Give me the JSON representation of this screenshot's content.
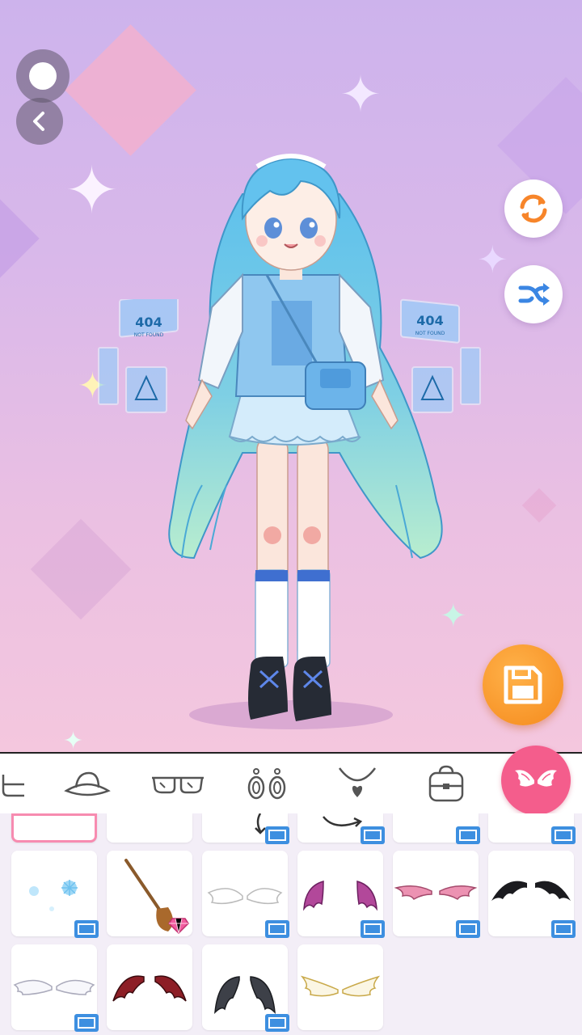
{
  "colors": {
    "accent_pink": "#f45d8c",
    "save_orange": "#f7941d",
    "video_badge_blue": "#3d8fe0",
    "side_icon_orange": "#f7852a",
    "side_icon_blue": "#3b86e3"
  },
  "stage": {
    "top_toggle": "toggle-switch",
    "back_icon": "chevron-left-icon",
    "refresh_icon": "refresh-icon",
    "shuffle_icon": "shuffle-icon",
    "save_icon": "floppy-disk-icon",
    "holo_sign_text": "404",
    "holo_sign_sub": "NOT FOUND"
  },
  "toolbar": {
    "categories": [
      {
        "name": "shoe",
        "icon": "shoe-icon"
      },
      {
        "name": "hat",
        "icon": "hat-icon"
      },
      {
        "name": "glasses",
        "icon": "glasses-icon"
      },
      {
        "name": "earrings",
        "icon": "earrings-icon"
      },
      {
        "name": "necklace",
        "icon": "necklace-icon"
      },
      {
        "name": "bag",
        "icon": "backpack-icon"
      },
      {
        "name": "wings",
        "icon": "wings-icon",
        "active": true
      }
    ]
  },
  "items": {
    "row_top_partial": [
      "selected",
      "plain",
      "arrow-down",
      "arrow-curve",
      "plain",
      "plain"
    ],
    "row1": [
      "snowflakes",
      "broom",
      "white-wings-small",
      "purple-bat-wings",
      "pink-bat-wings",
      "black-bat-wings"
    ],
    "row2": [
      "white-feather-wings",
      "red-demon-wings",
      "dark-feather-wings",
      "gold-angel-wings"
    ]
  }
}
